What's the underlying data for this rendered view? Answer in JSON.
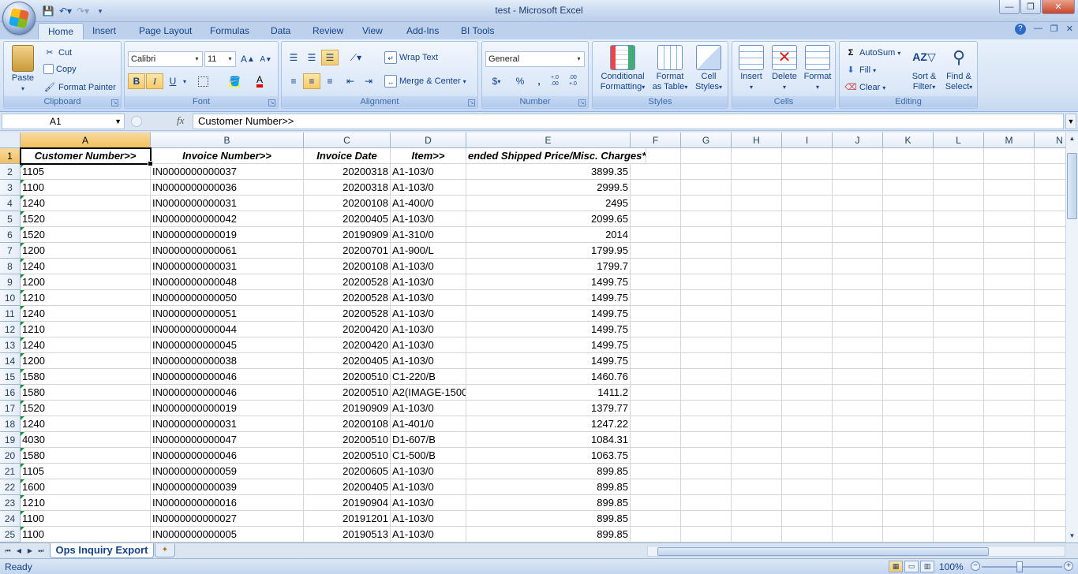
{
  "window": {
    "title": "test - Microsoft Excel"
  },
  "tabs": [
    "Home",
    "Insert",
    "Page Layout",
    "Formulas",
    "Data",
    "Review",
    "View",
    "Add-Ins",
    "BI Tools"
  ],
  "ribbon": {
    "clipboard": {
      "paste": "Paste",
      "cut": "Cut",
      "copy": "Copy",
      "format_painter": "Format Painter",
      "label": "Clipboard"
    },
    "font": {
      "name": "Calibri",
      "size": "11",
      "bold": "B",
      "italic": "I",
      "underline": "U",
      "label": "Font"
    },
    "alignment": {
      "wrap_text": "Wrap Text",
      "merge_center": "Merge & Center",
      "label": "Alignment"
    },
    "number": {
      "format": "General",
      "currency": "$",
      "percent": "%",
      "comma": ",",
      "inc_dec": "+.0 .00",
      "dec_dec": ".00 +.0",
      "label": "Number"
    },
    "styles": {
      "conditional": "Conditional",
      "conditional2": "Formatting",
      "format_as": "Format",
      "format_as2": "as Table",
      "cell": "Cell",
      "cell2": "Styles",
      "label": "Styles"
    },
    "cells": {
      "insert": "Insert",
      "delete": "Delete",
      "format": "Format",
      "label": "Cells"
    },
    "editing": {
      "autosum": "AutoSum",
      "fill": "Fill",
      "clear": "Clear",
      "sort": "Sort &",
      "sort2": "Filter",
      "find": "Find &",
      "find2": "Select",
      "label": "Editing"
    }
  },
  "formula_bar": {
    "name_box": "A1",
    "fx": "fx",
    "value": "Customer Number>>"
  },
  "columns": [
    "A",
    "B",
    "C",
    "D",
    "E",
    "F",
    "G",
    "H",
    "I",
    "J",
    "K",
    "L",
    "M",
    "N"
  ],
  "header_row": [
    "Customer Number>>",
    "Invoice Number>>",
    "Invoice Date",
    "Item>>",
    "ended Shipped Price/Misc. Charges*"
  ],
  "rows": [
    [
      "1105",
      "IN0000000000037",
      "20200318",
      "A1-103/0",
      "3899.35"
    ],
    [
      "1100",
      "IN0000000000036",
      "20200318",
      "A1-103/0",
      "2999.5"
    ],
    [
      "1240",
      "IN0000000000031",
      "20200108",
      "A1-400/0",
      "2495"
    ],
    [
      "1520",
      "IN0000000000042",
      "20200405",
      "A1-103/0",
      "2099.65"
    ],
    [
      "1520",
      "IN0000000000019",
      "20190909",
      "A1-310/0",
      "2014"
    ],
    [
      "1200",
      "IN0000000000061",
      "20200701",
      "A1-900/L",
      "1799.95"
    ],
    [
      "1240",
      "IN0000000000031",
      "20200108",
      "A1-103/0",
      "1799.7"
    ],
    [
      "1200",
      "IN0000000000048",
      "20200528",
      "A1-103/0",
      "1499.75"
    ],
    [
      "1210",
      "IN0000000000050",
      "20200528",
      "A1-103/0",
      "1499.75"
    ],
    [
      "1240",
      "IN0000000000051",
      "20200528",
      "A1-103/0",
      "1499.75"
    ],
    [
      "1210",
      "IN0000000000044",
      "20200420",
      "A1-103/0",
      "1499.75"
    ],
    [
      "1240",
      "IN0000000000045",
      "20200420",
      "A1-103/0",
      "1499.75"
    ],
    [
      "1200",
      "IN0000000000038",
      "20200405",
      "A1-103/0",
      "1499.75"
    ],
    [
      "1580",
      "IN0000000000046",
      "20200510",
      "C1-220/B",
      "1460.76"
    ],
    [
      "1580",
      "IN0000000000046",
      "20200510",
      "A2(IMAGE-1500",
      "1411.2"
    ],
    [
      "1520",
      "IN0000000000019",
      "20190909",
      "A1-103/0",
      "1379.77"
    ],
    [
      "1240",
      "IN0000000000031",
      "20200108",
      "A1-401/0",
      "1247.22"
    ],
    [
      "4030",
      "IN0000000000047",
      "20200510",
      "D1-607/B",
      "1084.31"
    ],
    [
      "1580",
      "IN0000000000046",
      "20200510",
      "C1-500/B",
      "1063.75"
    ],
    [
      "1105",
      "IN0000000000059",
      "20200605",
      "A1-103/0",
      "899.85"
    ],
    [
      "1600",
      "IN0000000000039",
      "20200405",
      "A1-103/0",
      "899.85"
    ],
    [
      "1210",
      "IN0000000000016",
      "20190904",
      "A1-103/0",
      "899.85"
    ],
    [
      "1100",
      "IN0000000000027",
      "20191201",
      "A1-103/0",
      "899.85"
    ],
    [
      "1100",
      "IN0000000000005",
      "20190513",
      "A1-103/0",
      "899.85"
    ]
  ],
  "sheet_tab": "Ops Inquiry Export",
  "status": {
    "text": "Ready",
    "zoom": "100%"
  }
}
